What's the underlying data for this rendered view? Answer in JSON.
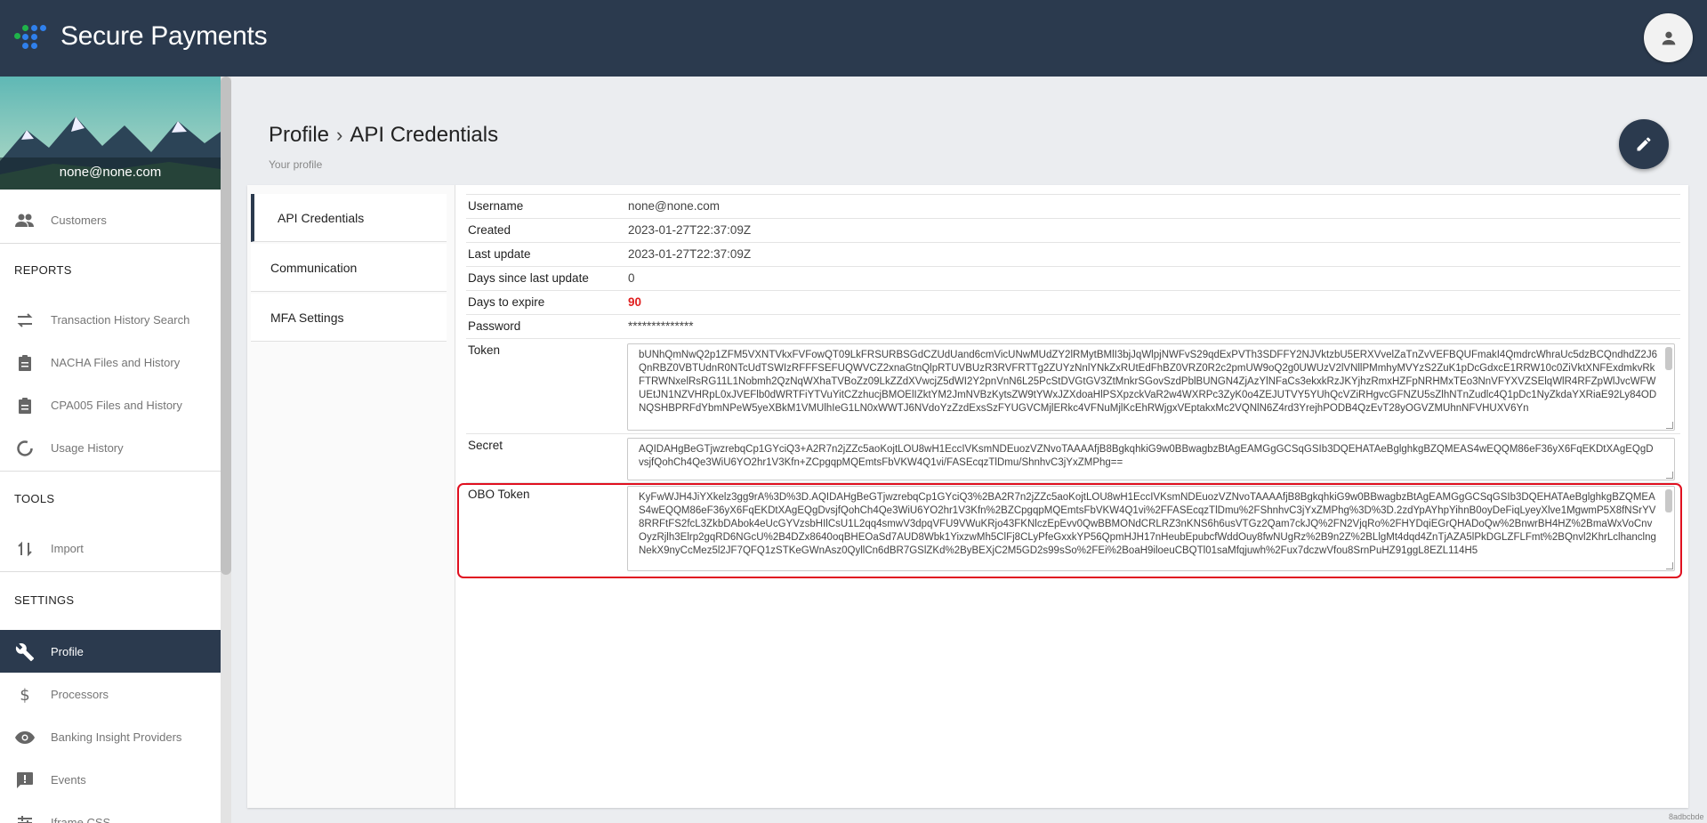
{
  "app": {
    "title": "Secure Payments"
  },
  "colors": {
    "topbar": "#2b3a4e",
    "accent": "#2b3a4e",
    "highlight": "#e01020",
    "warning_value": "#e02020"
  },
  "icons": {
    "logo": "dots-logo",
    "account": "person-icon",
    "edit": "pencil-icon"
  },
  "sidebar": {
    "user_email": "none@none.com",
    "customers": "Customers",
    "reports_header": "REPORTS",
    "reports": [
      {
        "label": "Transaction History Search",
        "icon": "swap-arrows-icon"
      },
      {
        "label": "NACHA Files and History",
        "icon": "clipboard-icon"
      },
      {
        "label": "CPA005 Files and History",
        "icon": "clipboard-icon"
      },
      {
        "label": "Usage History",
        "icon": "donut-icon"
      }
    ],
    "tools_header": "TOOLS",
    "import": "Import",
    "settings_header": "SETTINGS",
    "settings": [
      {
        "label": "Profile",
        "icon": "wrench-icon"
      },
      {
        "label": "Processors",
        "icon": "dollar-icon"
      },
      {
        "label": "Banking Insight Providers",
        "icon": "eye-icon"
      },
      {
        "label": "Events",
        "icon": "alert-message-icon"
      },
      {
        "label": "Iframe CSS",
        "icon": "tune-icon"
      }
    ]
  },
  "page": {
    "breadcrumb_parent": "Profile",
    "breadcrumb_current": "API Credentials",
    "subtitle": "Your profile"
  },
  "tabs": [
    "API Credentials",
    "Communication",
    "MFA Settings"
  ],
  "credentials": {
    "username_label": "Username",
    "username": "none@none.com",
    "created_label": "Created",
    "created": "2023-01-27T22:37:09Z",
    "updated_label": "Last update",
    "updated": "2023-01-27T22:37:09Z",
    "days_since_label": "Days since last update",
    "days_since": "0",
    "days_expire_label": "Days to expire",
    "days_expire": "90",
    "password_label": "Password",
    "password": "**************",
    "token_label": "Token",
    "token": "bUNhQmNwQ2p1ZFM5VXNTVkxFVFowQT09LkFRSURBSGdCZUdUand6cmVicUNwMUdZY2lRMytBMlI3bjJqWlpjNWFvS29qdExPVTh3SDFFY2NJVktzbU5ERXVvelZaTnZvVEFBQUFmakI4QmdrcWhraUc5dzBCQndhdZ2J6QnRBZ0VBTUdnR0NTcUdTSWIzRFFFSEFUQWVCZ2xnaGtnQlpRTUVBUzR3RVFRTTg2ZUYzNnlYNkZxRUtEdFhBZ0VRZ0R2c2pmUW9oQ2g0UWUzV2lVNllPMmhyMVYzS2ZuK1pDcGdxcE1RRW10c0ZiVktXNFExdmkvRkFTRWNxelRsRG11L1Nobmh2QzNqWXhaTVBoZz09LkZZdXVwcjZ5dWI2Y2pnVnN6L25PcStDVGtGV3ZtMnkrSGovSzdPblBUNGN4ZjAzYlNFaCs3ekxkRzJKYjhzRmxHZFpNRHMxTEo3NnVFYXVZSElqWlR4RFZpWlJvcWFWUEtJN1NZVHRpL0xJVEFlb0dWRTFiYTVuYitCZzhucjBMOElIZktYM2JmNVBzKytsZW9tYWxJZXdoaHlPSXpzckVaR2w4WXRPc3ZyK0o4ZEJUTVY5YUhQcVZiRHgvcGFNZU5sZlhNTnZudlc4Q1pDc1NyZkdaYXRiaE92Ly84ODNQSHBPRFdYbmNPeW5yeXBkM1VMUlhIeG1LN0xWWTJ6NVdoYzZzdExsSzFYUGVCMjlERkc4VFNuMjlKcEhRWjgxVEptakxMc2VQNlN6Z4rd3YrejhPODB4QzEvT28yOGVZMUhnNFVHUXV6Yn",
    "secret_label": "Secret",
    "secret": "AQIDAHgBeGTjwzrebqCp1GYciQ3+A2R7n2jZZc5aoKojtLOU8wH1EccIVKsmNDEuozVZNvoTAAAAfjB8BgkqhkiG9w0BBwagbzBtAgEAMGgGCSqGSIb3DQEHATAeBglghkgBZQMEAS4wEQQM86eF36yX6FqEKDtXAgEQgDvsjfQohCh4Qe3WiU6YO2hr1V3Kfn+ZCpgqpMQEmtsFbVKW4Q1vi/FASEcqzTlDmu/ShnhvC3jYxZMPhg==",
    "obo_label": "OBO Token",
    "obo": "KyFwWJH4JiYXkelz3gg9rA%3D%3D.AQIDAHgBeGTjwzrebqCp1GYciQ3%2BA2R7n2jZZc5aoKojtLOU8wH1EccIVKsmNDEuozVZNvoTAAAAfjB8BgkqhkiG9w0BBwagbzBtAgEAMGgGCSqGSIb3DQEHATAeBglghkgBZQMEAS4wEQQM86eF36yX6FqEKDtXAgEQgDvsjfQohCh4Qe3WiU6YO2hr1V3Kfn%2BZCpgqpMQEmtsFbVKW4Q1vi%2FFASEcqzTlDmu%2FShnhvC3jYxZMPhg%3D%3D.2zdYpAYhpYihnB0oyDeFiqLyeyXlve1MgwmP5X8fNSrYV8RRFtFS2fcL3ZkbDAbok4eUcGYVzsbHIlCsU1L2qq4smwV3dpqVFU9VWuKRjo43FKNlczEpEvv0QwBBMONdCRLRZ3nKNS6h6usVTGz2Qam7ckJQ%2FN2VjqRo%2FHYDqiEGrQHADoQw%2BnwrBH4HZ%2BmaWxVoCnvOyzRjlh3Elrp2gqRD6NGcU%2B4DZx8640oqBHEOaSd7AUD8Wbk1YixzwMh5ClFj8CLyPfeGxxkYP56QpmHJH17nHeubEpubcfWddOuy8fwNUgRz%2B9n2Z%2BLlgMt4dqd4ZnTjAZA5lPkDGLZFLFmt%2BQnvl2KhrLclhanclngNekX9nyCcMez5l2JF7QFQ1zSTKeGWnAsz0QyllCn6dBR7GSlZKd%2ByBEXjC2M5GD2s99sSo%2FEi%2BoaH9iloeuCBQTl01saMfqjuwh%2Fux7dczwVfou8SrnPuHZ91ggL8EZL114H5"
  },
  "footer": {
    "build": "8adbcbde"
  }
}
